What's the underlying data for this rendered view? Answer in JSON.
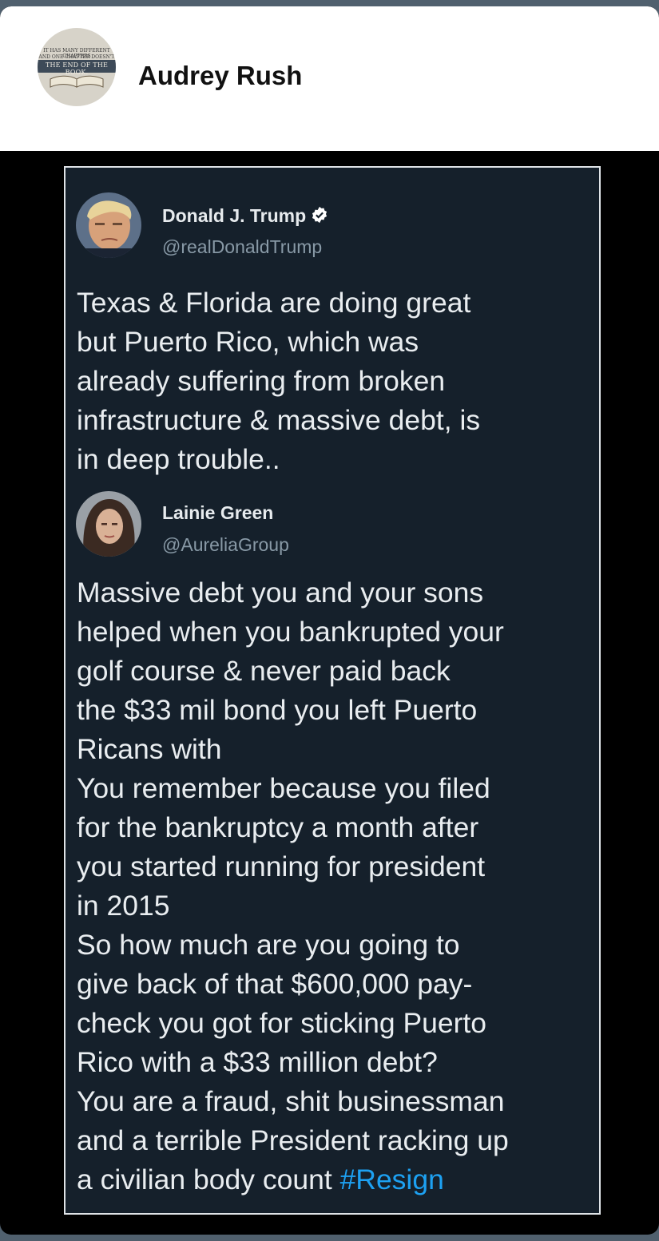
{
  "post": {
    "author_name": "Audrey Rush",
    "avatar_text_small_1": "IT HAS MANY DIFFERENT CHAPTERS",
    "avatar_text_small_2": "AND ONE CHAPTER DOESN'T MEAN IT'S",
    "avatar_text_main": "THE END OF THE BOOK."
  },
  "tweet": {
    "name": "Donald J. Trump",
    "handle": "@realDonaldTrump",
    "verified": true,
    "text": "Texas & Florida are doing great\nbut Puerto Rico, which was\nalready suffering from broken\ninfrastructure & massive debt, is\nin deep trouble.."
  },
  "reply": {
    "name": "Lainie Green",
    "handle": "@AureliaGroup",
    "text": "Massive debt you and your sons\nhelped when you bankrupted your\ngolf course & never paid back\nthe $33 mil bond you left Puerto\nRicans with\nYou remember because you filed\nfor the bankruptcy a month after\nyou started running for president\nin 2015\nSo how much are you going to\ngive back of that $600,000 pay-\ncheck you got for sticking Puerto\nRico with a $33 million debt?\nYou are a fraud, shit businessman\nand a terrible President racking up\na civilian body count ",
    "hashtag": "#Resign"
  },
  "colors": {
    "card_background": "#15202b",
    "text": "#e9edf0",
    "handle": "#8899a6",
    "hashtag": "#1da1f2",
    "header_background": "#ffffff"
  },
  "icons": {
    "verified": "verified-badge-icon"
  }
}
